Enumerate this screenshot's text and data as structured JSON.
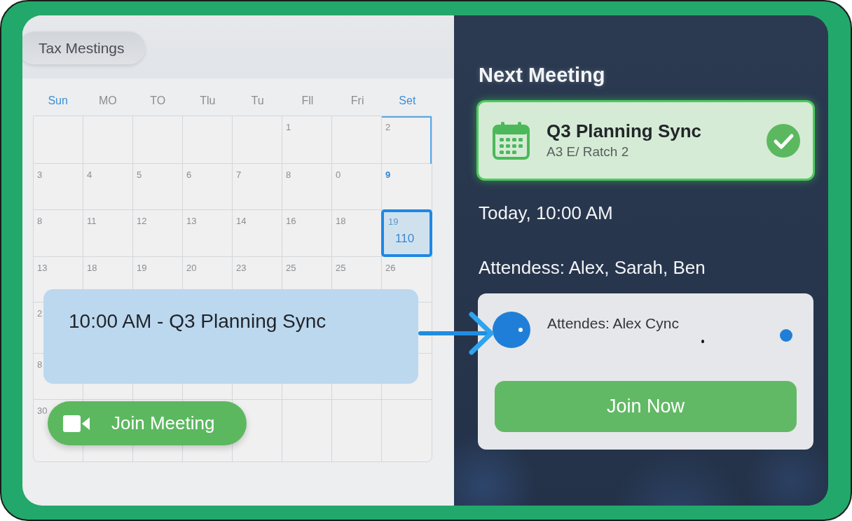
{
  "calendar": {
    "title": "Tax Mestings",
    "weekdays": [
      {
        "label": "Sun",
        "accent": true
      },
      {
        "label": "MO",
        "accent": false
      },
      {
        "label": "TO",
        "accent": false
      },
      {
        "label": "Tlu",
        "accent": false
      },
      {
        "label": "Tu",
        "accent": false
      },
      {
        "label": "Fll",
        "accent": false
      },
      {
        "label": "Fri",
        "accent": false
      },
      {
        "label": "Set",
        "accent": true
      }
    ],
    "weeks": [
      {
        "cells": [
          {},
          {},
          {},
          {},
          {},
          {
            "day": "1",
            "selected": false,
            "outlined": false,
            "accent": false
          },
          {},
          {
            "day": "2",
            "selected": false,
            "outlined": true,
            "accent": false
          }
        ]
      },
      {
        "cells": [
          {
            "day": "3",
            "selected": false,
            "outlined": false,
            "accent": false
          },
          {
            "day": "4",
            "selected": false,
            "outlined": false,
            "accent": false
          },
          {
            "day": "5",
            "selected": false,
            "outlined": false,
            "accent": false
          },
          {
            "day": "6",
            "selected": false,
            "outlined": false,
            "accent": false
          },
          {
            "day": "7",
            "selected": false,
            "outlined": false,
            "accent": false
          },
          {
            "day": "8",
            "selected": false,
            "outlined": false,
            "accent": false
          },
          {
            "day": "0",
            "selected": false,
            "outlined": false,
            "accent": false
          },
          {
            "day": "9",
            "selected": false,
            "outlined": false,
            "accent": true
          }
        ]
      },
      {
        "cells": [
          {
            "day": "8",
            "selected": false,
            "outlined": false,
            "accent": false
          },
          {
            "day": "11",
            "selected": false,
            "outlined": false,
            "accent": false
          },
          {
            "day": "12",
            "selected": false,
            "outlined": false,
            "accent": false
          },
          {
            "day": "13",
            "selected": false,
            "outlined": false,
            "accent": false
          },
          {
            "day": "14",
            "selected": false,
            "outlined": false,
            "accent": false
          },
          {
            "day": "16",
            "selected": false,
            "outlined": false,
            "accent": false
          },
          {
            "day": "18",
            "selected": false,
            "outlined": false,
            "accent": false
          },
          {
            "day": "19",
            "note": "110",
            "selected": true,
            "outlined": false,
            "accent": false
          }
        ]
      },
      {
        "cells": [
          {
            "day": "13",
            "selected": false,
            "outlined": false,
            "accent": false
          },
          {
            "day": "18",
            "selected": false,
            "outlined": false,
            "accent": false
          },
          {
            "day": "19",
            "selected": false,
            "outlined": false,
            "accent": false
          },
          {
            "day": "20",
            "selected": false,
            "outlined": false,
            "accent": false
          },
          {
            "day": "23",
            "selected": false,
            "outlined": false,
            "accent": false
          },
          {
            "day": "25",
            "selected": false,
            "outlined": false,
            "accent": false
          },
          {
            "day": "25",
            "selected": false,
            "outlined": false,
            "accent": false
          },
          {
            "day": "26",
            "selected": false,
            "outlined": false,
            "accent": false
          }
        ]
      },
      {
        "cells": [
          {
            "day": "2",
            "selected": false,
            "outlined": false,
            "accent": false
          },
          {},
          {},
          {},
          {},
          {},
          {},
          {}
        ]
      },
      {
        "cells": [
          {
            "day": "8",
            "selected": false,
            "outlined": false,
            "accent": false
          },
          {},
          {},
          {},
          {},
          {},
          {},
          {}
        ]
      },
      {
        "cells": [
          {
            "day": "30",
            "selected": false,
            "outlined": false,
            "accent": false
          },
          {},
          {},
          {},
          {},
          {},
          {},
          {}
        ]
      }
    ],
    "event": {
      "text": "10:00 AM - Q3 Planning Sync"
    },
    "join_button": {
      "label": "Join Meeting"
    }
  },
  "next_meeting": {
    "heading": "Next Meeting",
    "card": {
      "title": "Q3 Planning Sync",
      "subtitle": "A3 E/ Ratch 2",
      "confirmed": true
    },
    "time": "Today, 10:00 AM",
    "attendees": "Attendess: Alex, Sarah, Ben",
    "attendee_card": {
      "text": "Attendes: Alex Cync",
      "button": "Join Now"
    }
  }
}
